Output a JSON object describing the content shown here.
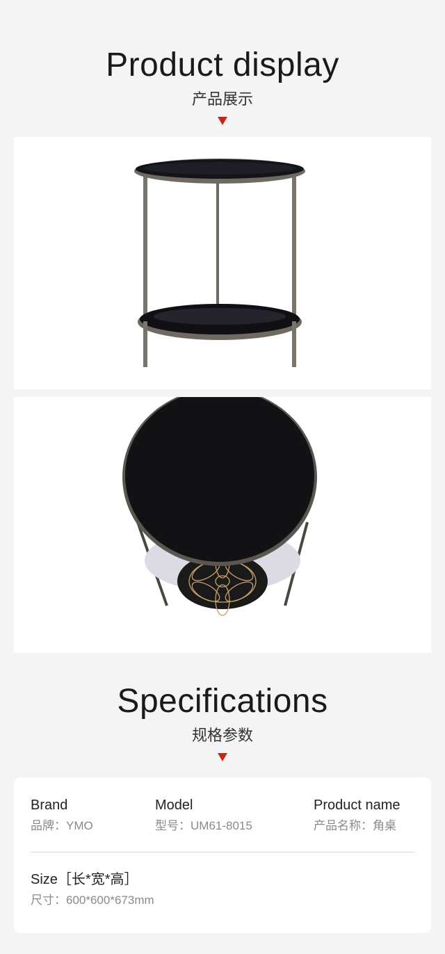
{
  "display": {
    "title_en": "Product display",
    "title_cn": "产品展示"
  },
  "photos": [
    {
      "view": "side-view"
    },
    {
      "view": "top-view"
    }
  ],
  "specs_section": {
    "title_en": "Specifications",
    "title_cn": "规格参数"
  },
  "specs": {
    "brand": {
      "label": "Brand",
      "value": "品牌：YMO"
    },
    "model": {
      "label": "Model",
      "value": "型号：UM61-8015"
    },
    "product_name": {
      "label": "Product name",
      "value": "产品名称：角桌"
    },
    "size": {
      "label": "Size［长*宽*高］",
      "value": "尺寸：600*600*673mm"
    }
  },
  "colors": {
    "accent_triangle": "#c4281c",
    "background": "#f4f4f4",
    "card": "#ffffff"
  }
}
